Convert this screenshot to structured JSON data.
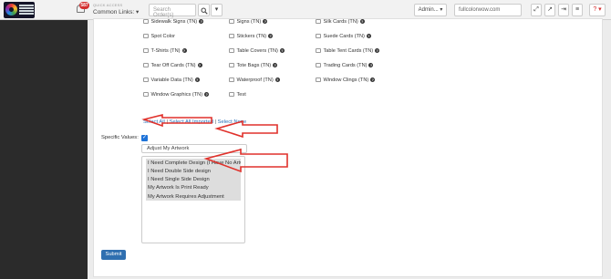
{
  "header": {
    "notification_count": "587",
    "quick_access_label": "QUICK ACCESS",
    "common_links_label": "Common Links: ▾",
    "search_placeholder": "Search Order(s)",
    "admin_label": "Admin... ▾",
    "domain_value": "fullcolorwow.com",
    "help_label": "? ▾"
  },
  "checkboxes": {
    "col1": [
      "Sidewalk Signs (TN)",
      "Spot Color",
      "T-Shirts (TN)",
      "Tear Off Cards (TN)",
      "Variable Data (TN)",
      "Window Graphics (TN)"
    ],
    "col2": [
      "Signs (TN)",
      "Stickers (TN)",
      "Table Covers (TN)",
      "Tote Bags (TN)",
      "Waterproof (TN)",
      "Test"
    ],
    "col3": [
      "Silk Cards (TN)",
      "Suede Cards (TN)",
      "Table Tent Cards (TN)",
      "Trading Cards (TN)",
      "Window Clings (TN)"
    ],
    "help_flags": {
      "col1": [
        true,
        false,
        true,
        true,
        true,
        true
      ],
      "col2": [
        true,
        true,
        true,
        true,
        true,
        false
      ],
      "col3": [
        true,
        true,
        true,
        true,
        true
      ]
    }
  },
  "select_links": {
    "select_all": "Select All",
    "sep1": " | ",
    "select_all_imported": "Select All Imported",
    "sep2": " | ",
    "select_none": "Select None"
  },
  "specific_values": {
    "label": "Specific Values:",
    "checked": true,
    "dropdown_value": "Adjust My Artwork",
    "options": [
      "I Need Complete Design (I Have No Artw",
      "I Need Double Side design",
      "I Need Single Side Design",
      "My Artwork Is Print Ready",
      "My Artwork Requires Adjustment"
    ]
  },
  "submit_label": "Submit",
  "colors": {
    "annotation_arrow": "#e0312b",
    "primary": "#2f6fb0",
    "sidebar": "#2b2b2b"
  }
}
